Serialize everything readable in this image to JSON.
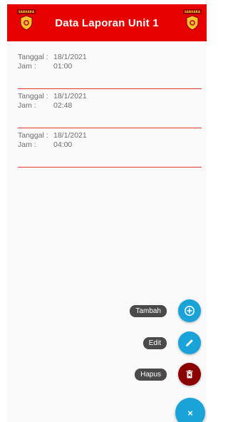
{
  "appbar": {
    "title": "Data Laporan Unit 1",
    "logo_text": "SABHARA",
    "background": "#e60000"
  },
  "reports": [
    {
      "date_label": "Tanggal :",
      "date": "18/1/2021",
      "time_label": "Jam :",
      "time": "01:00"
    },
    {
      "date_label": "Tanggal :",
      "date": "18/1/2021",
      "time_label": "Jam :",
      "time": "02:48"
    },
    {
      "date_label": "Tanggal :",
      "date": "18/1/2021",
      "time_label": "Jam :",
      "time": "04:00"
    }
  ],
  "actions": {
    "add_label": "Tambah",
    "edit_label": "Edit",
    "delete_label": "Hapus",
    "add_icon": "add-circle-icon",
    "edit_icon": "pencil-icon",
    "delete_icon": "trash-icon",
    "add_color": "#1aa3d9",
    "edit_color": "#1aa3d9",
    "delete_color": "#8b0000",
    "main_fab_glyph": "×"
  }
}
